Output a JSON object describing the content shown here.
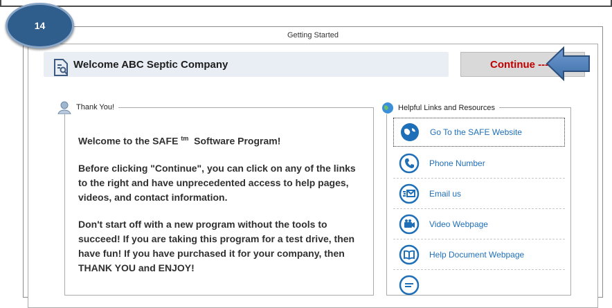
{
  "step_badge": "14",
  "window": {
    "title": "Getting Started"
  },
  "welcome": {
    "text": "Welcome ABC Septic Company"
  },
  "continue_button": {
    "label": "Continue ---"
  },
  "left_group": {
    "legend": "Thank You!",
    "heading": "Welcome to the SAFE",
    "heading_sup": "tm",
    "heading_tail": "Software Program!",
    "para1": "Before clicking \"Continue\", you can click on any of the links to the right and have unprecedented access to help pages, videos, and contact information.",
    "para2": "Don't start off with a new program without the tools to succeed! If you are taking this program for a test drive, then have fun! If you have purchased it for your company, then THANK YOU and ENJOY!"
  },
  "right_group": {
    "legend": "Helpful Links and Resources",
    "links": [
      {
        "label": "Go To the SAFE Website",
        "icon": "globe-icon"
      },
      {
        "label": "Phone Number",
        "icon": "phone-icon"
      },
      {
        "label": "Email us",
        "icon": "email-icon"
      },
      {
        "label": "Video Webpage",
        "icon": "video-camera-icon"
      },
      {
        "label": "Help Document Webpage",
        "icon": "book-icon"
      },
      {
        "label": "",
        "icon": "chat-icon"
      }
    ]
  },
  "colors": {
    "accent_blue": "#1e6fb8",
    "continue_red": "#c00000",
    "badge_blue": "#2f5d8c"
  }
}
